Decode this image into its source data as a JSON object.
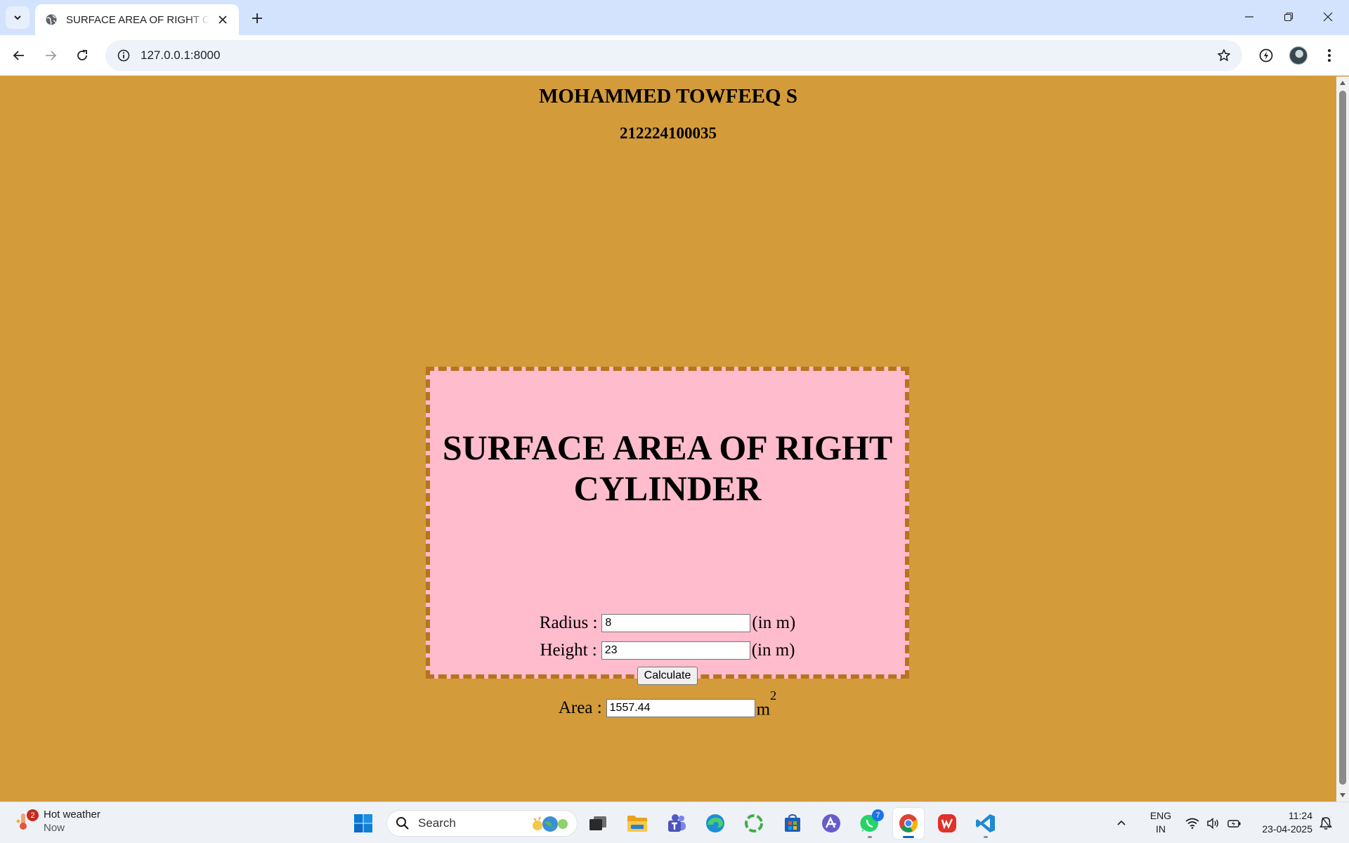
{
  "browser": {
    "tab_title": "SURFACE AREA OF RIGHT CYLINDER",
    "url": "127.0.0.1:8000"
  },
  "page": {
    "author": "MOHAMMED TOWFEEQ S",
    "register_number": "212224100035",
    "heading": "SURFACE AREA OF RIGHT CYLINDER",
    "radius_label": "Radius :",
    "radius_value": "8",
    "radius_unit": "(in m)",
    "height_label": "Height :",
    "height_value": "23",
    "height_unit": "(in m)",
    "calculate_label": "Calculate",
    "area_label": "Area :",
    "area_value": "1557.44",
    "area_unit": "m",
    "area_unit_exponent": "2"
  },
  "taskbar": {
    "weather_title": "Hot weather",
    "weather_subtitle": "Now",
    "weather_badge": "2",
    "search_label": "Search",
    "whatsapp_badge": "7",
    "lang_line1": "ENG",
    "lang_line2": "IN",
    "time": "11:24",
    "date": "23-04-2025"
  },
  "colors": {
    "page_background": "#d39b3a",
    "card_background": "#ffbccd",
    "card_border": "#b8731f"
  }
}
